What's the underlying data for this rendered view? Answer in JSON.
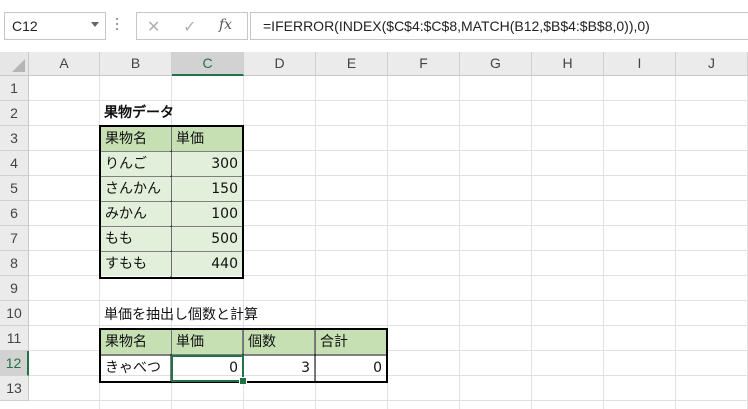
{
  "name_box": {
    "value": "C12"
  },
  "formula_bar": {
    "cancel_icon": "✕",
    "enter_icon": "✓",
    "fx_label": "fx",
    "formula": "=IFERROR(INDEX($C$4:$C$8,MATCH(B12,$B$4:$B$8,0)),0)"
  },
  "columns": [
    "A",
    "B",
    "C",
    "D",
    "E",
    "F",
    "G",
    "H",
    "I",
    "J"
  ],
  "rows": [
    "1",
    "2",
    "3",
    "4",
    "5",
    "6",
    "7",
    "8",
    "9",
    "10",
    "11",
    "12",
    "13"
  ],
  "sheet": {
    "table1_title": "果物データ",
    "table1_headers": [
      "果物名",
      "単価"
    ],
    "table1_rows": [
      {
        "name": "りんご",
        "price": "300"
      },
      {
        "name": "さんかん",
        "price": "150"
      },
      {
        "name": "みかん",
        "price": "100"
      },
      {
        "name": "もも",
        "price": "500"
      },
      {
        "name": "すもも",
        "price": "440"
      }
    ],
    "table2_title": "単価を抽出し個数と計算",
    "table2_headers": [
      "果物名",
      "単価",
      "個数",
      "合計"
    ],
    "table2_row": {
      "name": "きゃべつ",
      "price": "0",
      "qty": "3",
      "total": "0"
    }
  },
  "selected_cell": "C12",
  "colors": {
    "header_green": "#c6e0b4",
    "light_green": "#e2efda",
    "excel_green": "#217346"
  }
}
